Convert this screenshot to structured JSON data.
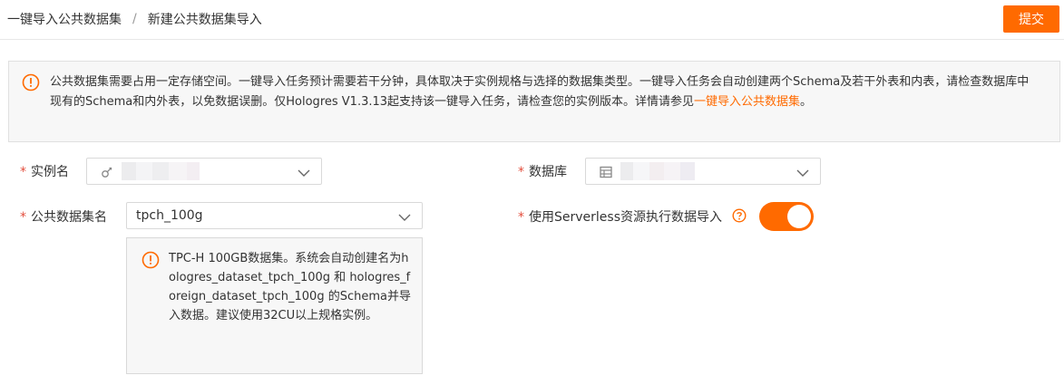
{
  "breadcrumb": {
    "items": [
      "一键导入公共数据集",
      "新建公共数据集导入"
    ],
    "separator": "/"
  },
  "toolbar": {
    "submit_label": "提交"
  },
  "notice": {
    "text": "公共数据集需要占用一定存储空间。一键导入任务预计需要若干分钟，具体取决于实例规格与选择的数据集类型。一键导入任务会自动创建两个Schema及若干外表和内表，请检查数据库中现有的Schema和内外表，以免数据误删。仅Hologres V1.3.13起支持该一键导入任务，请检查您的实例版本。详情请参见",
    "link_text": "一键导入公共数据集",
    "suffix": "。",
    "icon": "info-circle-icon"
  },
  "form": {
    "required_mark": "*",
    "instance": {
      "label": "实例名",
      "value": "",
      "icon": "instance-icon"
    },
    "database": {
      "label": "数据库",
      "value": "",
      "icon": "database-icon"
    },
    "dataset": {
      "label": "公共数据集名",
      "value": "tpch_100g"
    },
    "serverless": {
      "label": "使用Serverless资源执行数据导入",
      "enabled": true,
      "help_icon": "question-circle-icon"
    },
    "dataset_tip": {
      "icon": "info-circle-icon",
      "text": "TPC-H 100GB数据集。系统会自动创建名为hologres_dataset_tpch_100g 和 hologres_foreign_dataset_tpch_100g 的Schema并导入数据。建议使用32CU以上规格实例。"
    }
  },
  "colors": {
    "accent": "#ff6a00",
    "required": "#e34d3c"
  }
}
